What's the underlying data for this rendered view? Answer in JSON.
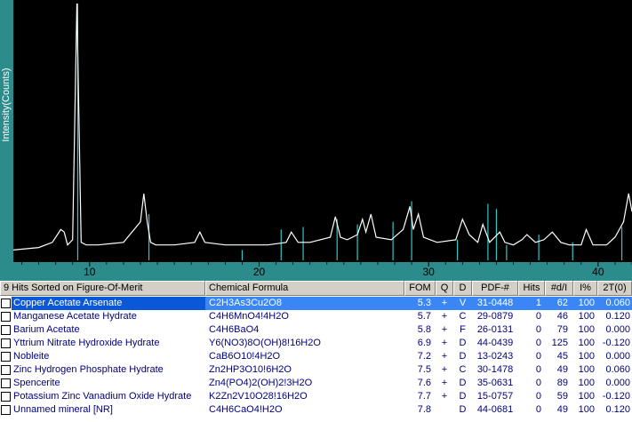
{
  "chart_data": {
    "type": "line",
    "ylabel": "Intensity(Counts)",
    "xlabel": "",
    "xlim": [
      5.5,
      42
    ],
    "x_ticks": [
      10,
      20,
      30,
      40
    ],
    "x_tick_labels": [
      "10",
      "20",
      "30",
      "40"
    ],
    "ylim": [
      0,
      100
    ],
    "grid": false,
    "series": [
      {
        "x": [
          5.5,
          7,
          7.8,
          8.3,
          8.5,
          8.7,
          9.0,
          9.25,
          9.5,
          9.8,
          10.5,
          12,
          13.0,
          13.2,
          13.4,
          13.6,
          13.9,
          15,
          16.2,
          16.5,
          16.8,
          18,
          19.2,
          20.5,
          21.6,
          21.9,
          22.3,
          23,
          24.2,
          24.5,
          24.8,
          25.2,
          25.8,
          26.1,
          26.3,
          26.6,
          26.9,
          27.8,
          28.5,
          28.9,
          29.1,
          29.4,
          29.7,
          30.5,
          31.6,
          32.0,
          32.4,
          32.9,
          33.2,
          33.6,
          34.2,
          34.5,
          35.0,
          35.5,
          35.8,
          36.3,
          36.8,
          37.3,
          37.8,
          38.3,
          39.0,
          39.3,
          39.7,
          40.5,
          41.0,
          41.5,
          41.8,
          42.0
        ],
        "y": [
          4,
          5,
          7,
          12,
          11,
          6,
          8,
          100,
          7,
          6,
          6,
          7,
          15,
          26,
          15,
          7,
          6,
          6,
          7,
          11,
          7,
          6,
          6,
          6,
          7,
          11,
          7,
          7,
          9,
          17,
          9,
          8,
          10,
          16,
          11,
          18,
          9,
          8,
          12,
          21,
          12,
          18,
          9,
          7,
          8,
          16,
          10,
          7,
          14,
          7,
          11,
          7,
          6,
          8,
          10,
          7,
          8,
          11,
          7,
          6,
          6,
          12,
          6,
          6,
          9,
          15,
          26,
          19
        ]
      }
    ],
    "reference_sticks": [
      {
        "x": 9.3,
        "height": 100
      },
      {
        "x": 13.5,
        "height": 18
      },
      {
        "x": 19.0,
        "height": 4
      },
      {
        "x": 21.3,
        "height": 12
      },
      {
        "x": 22.6,
        "height": 13
      },
      {
        "x": 24.6,
        "height": 16
      },
      {
        "x": 25.8,
        "height": 14
      },
      {
        "x": 27.9,
        "height": 15
      },
      {
        "x": 29.0,
        "height": 23
      },
      {
        "x": 31.7,
        "height": 8
      },
      {
        "x": 33.5,
        "height": 22
      },
      {
        "x": 34.0,
        "height": 20
      },
      {
        "x": 34.6,
        "height": 6
      },
      {
        "x": 36.5,
        "height": 10
      },
      {
        "x": 38.5,
        "height": 7
      },
      {
        "x": 41.4,
        "height": 13
      }
    ],
    "colors": {
      "background": "#000000",
      "trace": "#ffffff",
      "sticks": "#33c7c7",
      "axis_strip": "#2c8c8c"
    }
  },
  "hits_table": {
    "columns": [
      "9 Hits Sorted on Figure-Of-Merit",
      "Chemical Formula",
      "FOM",
      "Q",
      "D",
      "PDF-#",
      "Hits",
      "#d/I",
      "I%",
      "2T(0)"
    ],
    "rows": [
      {
        "name": "Copper Acetate Arsenate",
        "formula": "C2H3As3Cu2O8",
        "fom": "5.3",
        "q": "+",
        "d": "V",
        "pdf": "31-0448",
        "hits": "1",
        "di": "62",
        "ipct": "100",
        "t2": "0.060",
        "selected": true
      },
      {
        "name": "Manganese Acetate Hydrate",
        "formula": "C4H6MnO4!4H2O",
        "fom": "5.7",
        "q": "+",
        "d": "C",
        "pdf": "29-0879",
        "hits": "0",
        "di": "46",
        "ipct": "100",
        "t2": "0.120",
        "selected": false
      },
      {
        "name": "Barium Acetate",
        "formula": "C4H6BaO4",
        "fom": "5.8",
        "q": "+",
        "d": "F",
        "pdf": "26-0131",
        "hits": "0",
        "di": "79",
        "ipct": "100",
        "t2": "0.000",
        "selected": false
      },
      {
        "name": "Yttrium Nitrate Hydroxide Hydrate",
        "formula": "Y6(NO3)8O(OH)8!16H2O",
        "fom": "6.9",
        "q": "+",
        "d": "D",
        "pdf": "44-0439",
        "hits": "0",
        "di": "125",
        "ipct": "100",
        "t2": "-0.120",
        "selected": false
      },
      {
        "name": "Nobleite",
        "formula": "CaB6O10!4H2O",
        "fom": "7.2",
        "q": "+",
        "d": "D",
        "pdf": "13-0243",
        "hits": "0",
        "di": "45",
        "ipct": "100",
        "t2": "0.000",
        "selected": false
      },
      {
        "name": "Zinc Hydrogen Phosphate Hydrate",
        "formula": "Zn2HP3O10!6H2O",
        "fom": "7.5",
        "q": "+",
        "d": "C",
        "pdf": "30-1478",
        "hits": "0",
        "di": "49",
        "ipct": "100",
        "t2": "0.060",
        "selected": false
      },
      {
        "name": "Spencerite",
        "formula": "Zn4(PO4)2(OH)2!3H2O",
        "fom": "7.6",
        "q": "+",
        "d": "D",
        "pdf": "35-0631",
        "hits": "0",
        "di": "89",
        "ipct": "100",
        "t2": "0.000",
        "selected": false
      },
      {
        "name": "Potassium Zinc Vanadium Oxide Hydrate",
        "formula": "K2Zn2V10O28!16H2O",
        "fom": "7.7",
        "q": "+",
        "d": "D",
        "pdf": "15-0757",
        "hits": "0",
        "di": "59",
        "ipct": "100",
        "t2": "-0.120",
        "selected": false
      },
      {
        "name": "Unnamed mineral [NR]",
        "formula": "C4H6CaO4!H2O",
        "fom": "7.8",
        "q": "",
        "d": "D",
        "pdf": "44-0681",
        "hits": "0",
        "di": "49",
        "ipct": "100",
        "t2": "0.120",
        "selected": false
      }
    ]
  }
}
